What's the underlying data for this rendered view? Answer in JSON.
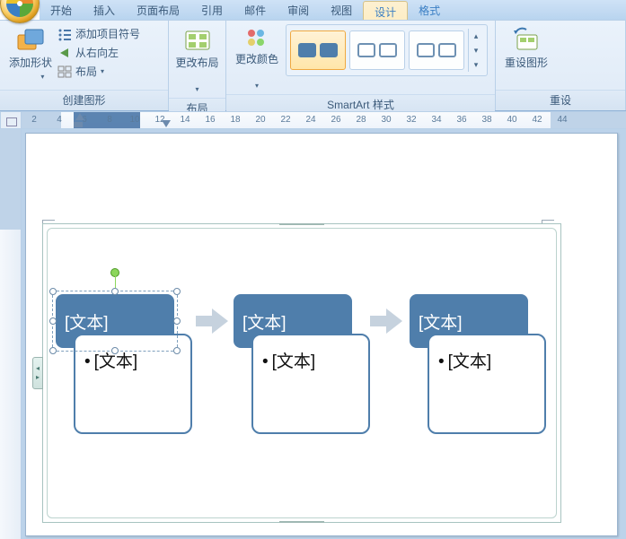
{
  "tabs": {
    "items": [
      "开始",
      "插入",
      "页面布局",
      "引用",
      "邮件",
      "审阅",
      "视图",
      "设计",
      "格式"
    ],
    "active_index": 7
  },
  "ribbon": {
    "create_group": {
      "title": "创建图形",
      "add_shape": "添加形状",
      "add_bullet": "添加项目符号",
      "rtl": "从右向左",
      "layout": "布局"
    },
    "layout_group": {
      "title": "布局",
      "change_layout": "更改布局"
    },
    "style_group": {
      "title": "SmartArt 样式",
      "change_colors": "更改颜色"
    },
    "reset_group": {
      "title": "重设",
      "reset_graphic": "重设图形"
    }
  },
  "ruler": {
    "labels": [
      "2",
      "4",
      "6",
      "8",
      "10",
      "12",
      "14",
      "16",
      "18",
      "20",
      "22",
      "24",
      "26",
      "28",
      "30",
      "32",
      "34",
      "36",
      "38",
      "40",
      "42",
      "44"
    ]
  },
  "smartart": {
    "nodes": [
      {
        "title": "[文本]",
        "child": "[文本]"
      },
      {
        "title": "[文本]",
        "child": "[文本]"
      },
      {
        "title": "[文本]",
        "child": "[文本]"
      }
    ]
  }
}
